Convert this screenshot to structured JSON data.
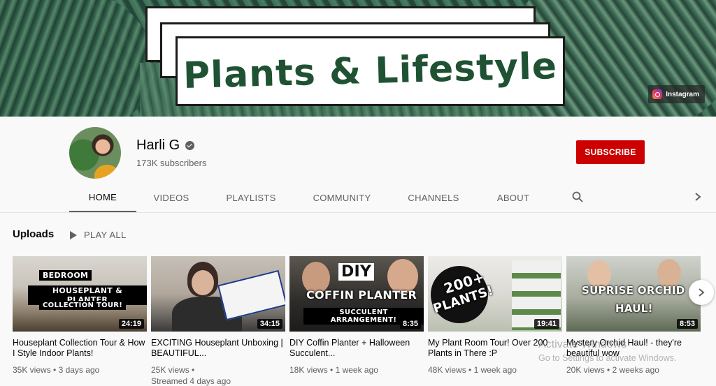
{
  "banner": {
    "title": "Plants & Lifestyle",
    "instagram_label": "Instagram"
  },
  "channel": {
    "name": "Harli G",
    "subscribers": "173K subscribers",
    "subscribe_label": "SUBSCRIBE"
  },
  "tabs": [
    {
      "label": "HOME",
      "active": true
    },
    {
      "label": "VIDEOS",
      "active": false
    },
    {
      "label": "PLAYLISTS",
      "active": false
    },
    {
      "label": "COMMUNITY",
      "active": false
    },
    {
      "label": "CHANNELS",
      "active": false
    },
    {
      "label": "ABOUT",
      "active": false
    }
  ],
  "section": {
    "title": "Uploads",
    "play_all_label": "PLAY ALL"
  },
  "videos": [
    {
      "title": "Houseplant Collection Tour & How I Style Indoor Plants!",
      "views": "35K views",
      "age": "3 days ago",
      "duration": "24:19",
      "thumb_text": [
        "BEDROOM",
        "HOUSEPLANT & PLANTER",
        "COLLECTION TOUR!"
      ]
    },
    {
      "title": "EXCITING Houseplant Unboxing | BEAUTIFUL...",
      "views": "25K views",
      "age": "Streamed 4 days ago",
      "duration": "34:15",
      "thumb_text": []
    },
    {
      "title": "DIY Coffin Planter + Halloween Succulent...",
      "views": "18K views",
      "age": "1 week ago",
      "duration": "8:35",
      "thumb_text": [
        "DIY",
        "COFFIN PLANTER",
        "SUCCULENT ARRANGEMENT!"
      ]
    },
    {
      "title": "My Plant Room Tour! Over 200 Plants in There :P",
      "views": "48K views",
      "age": "1 week ago",
      "duration": "19:41",
      "thumb_text": [
        "200+",
        "PLANTS!"
      ]
    },
    {
      "title": "Mystery Orchid Haul! - they're beautiful wow",
      "views": "20K views",
      "age": "2 weeks ago",
      "duration": "8:53",
      "thumb_text": [
        "SUPRISE ORCHID",
        "HAUL!"
      ]
    }
  ],
  "watermark": {
    "line1": "Activate Windows",
    "line2": "Go to Settings to activate Windows."
  },
  "icons": {
    "search": "search-icon",
    "next": "chevron-right-icon",
    "verified": "verified-icon",
    "play": "play-icon",
    "instagram": "instagram-icon"
  },
  "colors": {
    "subscribe": "#cc0000",
    "banner_title": "#1f5233"
  }
}
